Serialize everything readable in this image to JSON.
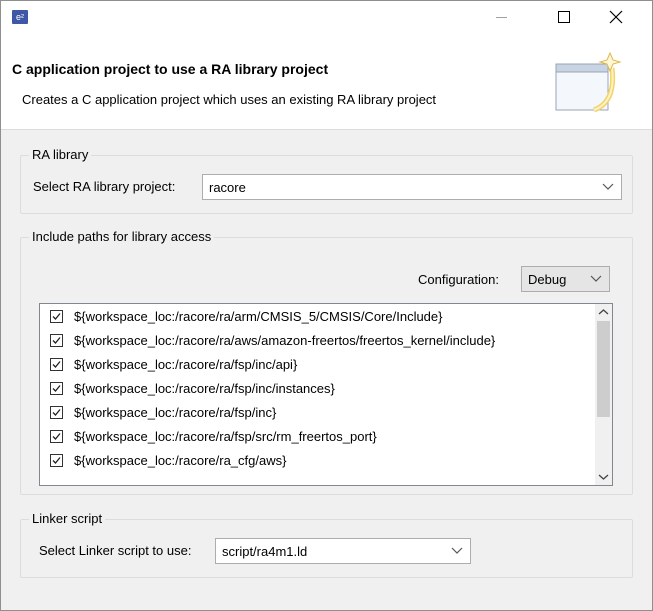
{
  "window": {
    "app_icon_label": "e²",
    "minimize_glyph": "—",
    "maximize_glyph": "☐",
    "close_glyph": "✕"
  },
  "header": {
    "title": "C application project to use a RA library project",
    "description": "Creates a C application project which uses an existing RA library project",
    "icon": "wizard-banner-icon"
  },
  "ra_library": {
    "group_title": "RA library",
    "select_label": "Select RA library project:",
    "selected_value": "racore"
  },
  "include_paths": {
    "group_title": "Include paths for library access",
    "configuration_label": "Configuration:",
    "configuration_value": "Debug",
    "items": [
      {
        "label": "${workspace_loc:/racore/ra/arm/CMSIS_5/CMSIS/Core/Include}",
        "checked": true
      },
      {
        "label": "${workspace_loc:/racore/ra/aws/amazon-freertos/freertos_kernel/include}",
        "checked": true
      },
      {
        "label": "${workspace_loc:/racore/ra/fsp/inc/api}",
        "checked": true
      },
      {
        "label": "${workspace_loc:/racore/ra/fsp/inc/instances}",
        "checked": true
      },
      {
        "label": "${workspace_loc:/racore/ra/fsp/inc}",
        "checked": true
      },
      {
        "label": "${workspace_loc:/racore/ra/fsp/src/rm_freertos_port}",
        "checked": true
      },
      {
        "label": "${workspace_loc:/racore/ra_cfg/aws}",
        "checked": true
      }
    ]
  },
  "linker": {
    "group_title": "Linker script",
    "select_label": "Select Linker script to use:",
    "selected_value": "script/ra4m1.ld"
  },
  "colors": {
    "app_icon_bg": "#3e57a6",
    "dialog_bg": "#f0f0f0",
    "header_bg": "#ffffff"
  }
}
